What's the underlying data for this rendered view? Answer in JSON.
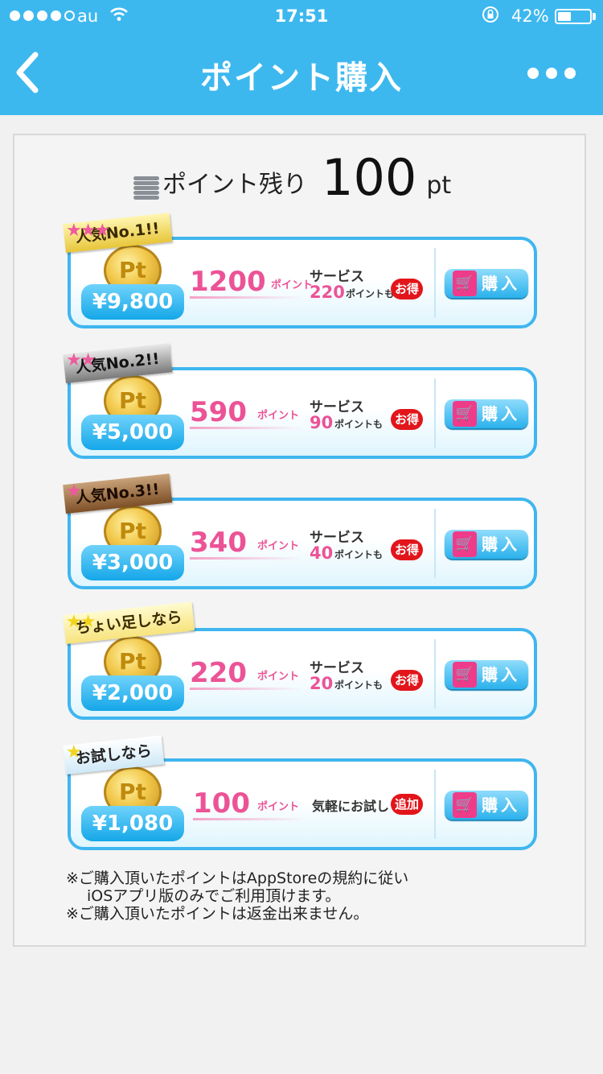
{
  "status_bar": {
    "carrier": "au",
    "time": "17:51",
    "battery": "42%",
    "battery_level": 0.42,
    "signal_bars": 4,
    "signal_total": 5
  },
  "nav": {
    "title": "ポイント購入",
    "back_icon": "chevron-left-icon",
    "more_icon": "more-dots-icon"
  },
  "balance": {
    "label": "ポイント残り",
    "value": "100",
    "unit": "pt"
  },
  "plans": [
    {
      "ribbon": "人気No.1!!",
      "stars": "★★★",
      "price": "¥9,800",
      "points": "1200",
      "points_unit": "ポイント",
      "service_label": "サービス",
      "service_value": "220",
      "service_unit": "ポイントも",
      "deal": "お得",
      "buy": "購入"
    },
    {
      "ribbon": "人気No.2!!",
      "stars": "★★",
      "price": "¥5,000",
      "points": "590",
      "points_unit": "ポイント",
      "service_label": "サービス",
      "service_value": "90",
      "service_unit": "ポイントも",
      "deal": "お得",
      "buy": "購入"
    },
    {
      "ribbon": "人気No.3!!",
      "stars": "★",
      "price": "¥3,000",
      "points": "340",
      "points_unit": "ポイント",
      "service_label": "サービス",
      "service_value": "40",
      "service_unit": "ポイントも",
      "deal": "お得",
      "buy": "購入"
    },
    {
      "ribbon": "ちょい足しなら",
      "stars": "★★",
      "price": "¥2,000",
      "points": "220",
      "points_unit": "ポイント",
      "service_label": "サービス",
      "service_value": "20",
      "service_unit": "ポイントも",
      "deal": "お得",
      "buy": "購入"
    },
    {
      "ribbon": "お試しなら",
      "stars": "★",
      "price": "¥1,080",
      "points": "100",
      "points_unit": "ポイント",
      "trial_text": "気軽にお試し",
      "deal": "追加",
      "buy": "購入"
    }
  ],
  "coin_label": "Pt",
  "notes": [
    "※ご購入頂いたポイントはAppStoreの規約に従い",
    "iOSアプリ版のみでご利用頂けます。",
    "※ご購入頂いたポイントは返金出来ません。"
  ],
  "colors": {
    "nav_bg": "#3db8ef",
    "accent_pink": "#ec5396",
    "deal_red": "#e2151b",
    "price_blue": "#15a7e8"
  }
}
